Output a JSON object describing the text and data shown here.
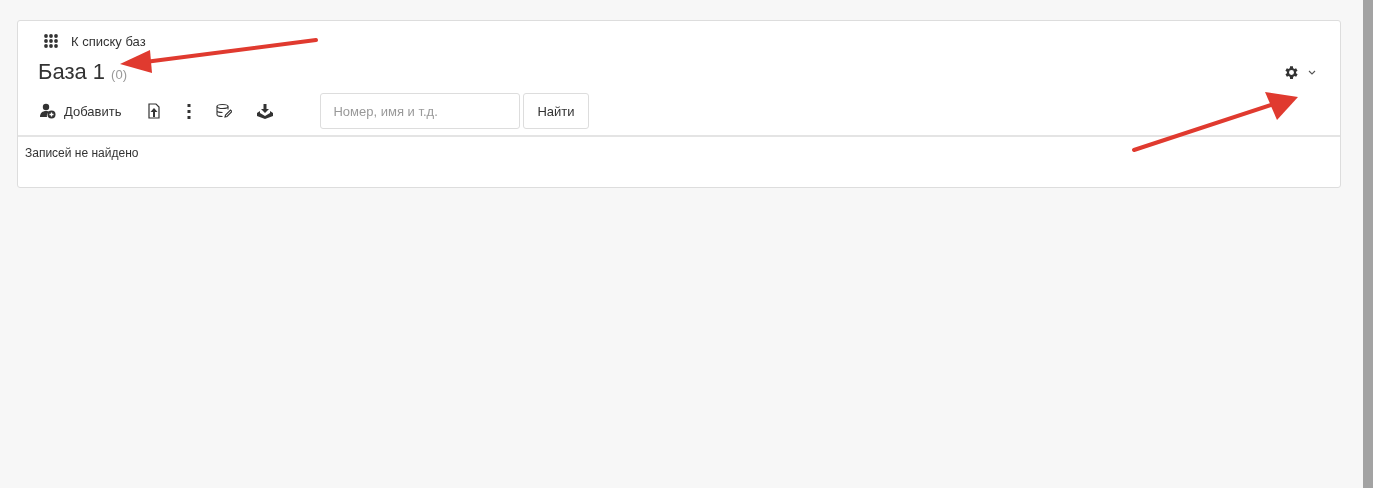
{
  "back_link": {
    "label": "К списку баз"
  },
  "header": {
    "title": "База 1",
    "count": "(0)"
  },
  "toolbar": {
    "add_label": "Добавить",
    "search": {
      "placeholder": "Номер, имя и т.д."
    },
    "search_button": "Найти"
  },
  "empty_message": "Записей не найдено"
}
